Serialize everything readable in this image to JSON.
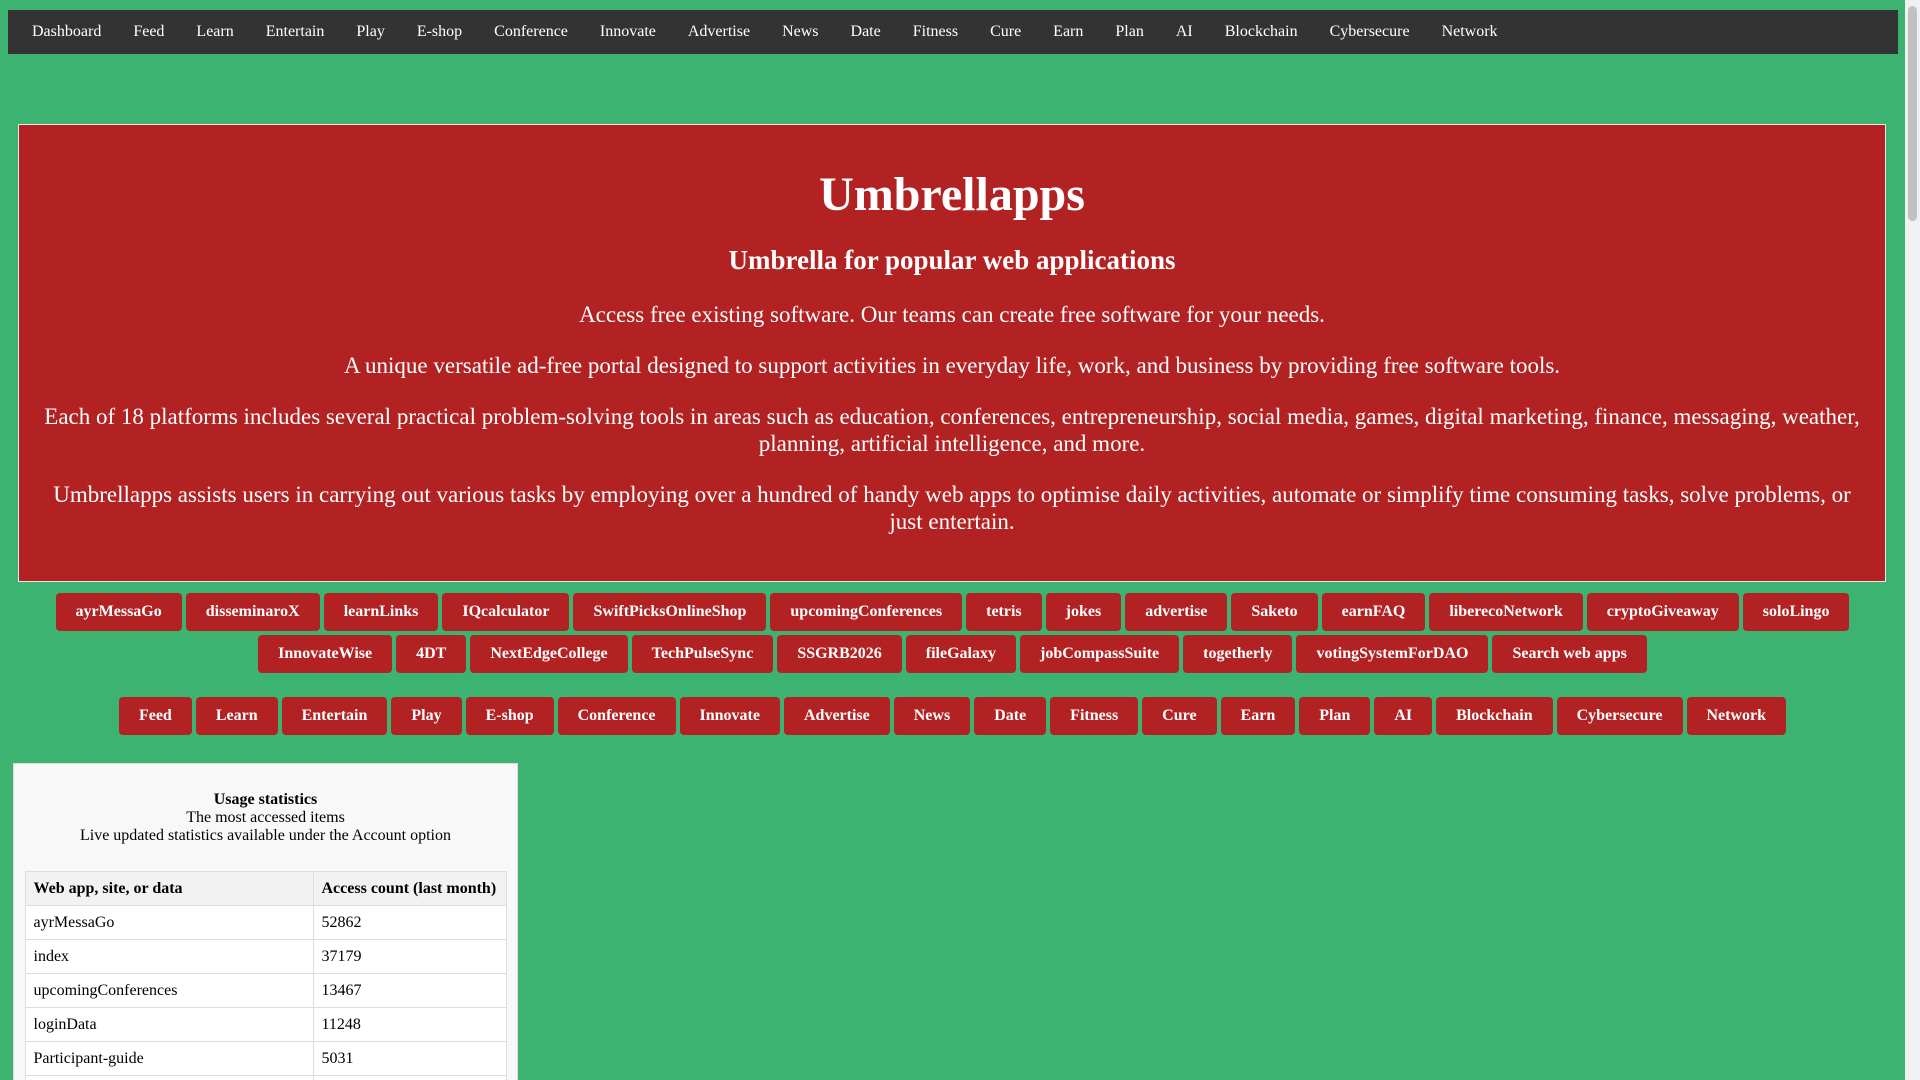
{
  "topnav": {
    "items": [
      "Dashboard",
      "Feed",
      "Learn",
      "Entertain",
      "Play",
      "E-shop",
      "Conference",
      "Innovate",
      "Advertise",
      "News",
      "Date",
      "Fitness",
      "Cure",
      "Earn",
      "Plan",
      "AI",
      "Blockchain",
      "Cybersecure",
      "Network"
    ]
  },
  "hero": {
    "title": "Umbrellapps",
    "subtitle": "Umbrella for popular web applications",
    "p1": "Access free existing software. Our teams can create free software for your needs.",
    "p2": "A unique versatile ad-free portal designed to support activities in everyday life, work, and business by providing free software tools.",
    "p3": "Each of 18 platforms includes several practical problem-solving tools in areas such as education, conferences, entrepreneurship, social media, games, digital marketing, finance, messaging, weather, planning, artificial intelligence, and more.",
    "p4": "Umbrellapps assists users in carrying out various tasks by employing over a hundred of handy web apps to optimise daily activities, automate or simplify time consuming tasks, solve problems, or just entertain."
  },
  "apps": [
    "ayrMessaGo",
    "disseminaroX",
    "learnLinks",
    "IQcalculator",
    "SwiftPicksOnlineShop",
    "upcomingConferences",
    "tetris",
    "jokes",
    "advertise",
    "Saketo",
    "earnFAQ",
    "liberecoNetwork",
    "cryptoGiveaway",
    "soloLingo",
    "InnovateWise",
    "4DT",
    "NextEdgeCollege",
    "TechPulseSync",
    "SSGRB2026",
    "fileGalaxy",
    "jobCompassSuite",
    "togetherly",
    "votingSystemForDAO",
    "Search web apps"
  ],
  "categories": [
    "Feed",
    "Learn",
    "Entertain",
    "Play",
    "E-shop",
    "Conference",
    "Innovate",
    "Advertise",
    "News",
    "Date",
    "Fitness",
    "Cure",
    "Earn",
    "Plan",
    "AI",
    "Blockchain",
    "Cybersecure",
    "Network"
  ],
  "stats": {
    "title": "Usage statistics",
    "subtitle": "The most accessed items",
    "note": "Live updated statistics available under the Account option",
    "headers": [
      "Web app, site, or data",
      "Access count (last month)"
    ],
    "rows": [
      [
        "ayrMessaGo",
        "52862"
      ],
      [
        "index",
        "37179"
      ],
      [
        "upcomingConferences",
        "13467"
      ],
      [
        "loginData",
        "11248"
      ],
      [
        "Participant-guide",
        "5031"
      ],
      [
        "",
        ""
      ]
    ]
  },
  "colors": {
    "page_bg": "#3cb371",
    "nav_bg": "#333333",
    "accent_red": "#b22222"
  }
}
